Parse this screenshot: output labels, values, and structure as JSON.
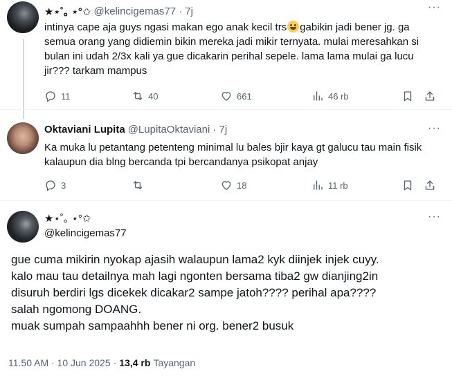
{
  "tweets": [
    {
      "name": "★⋆˚｡ ⋆°✩",
      "handle": "@kelincigemas77",
      "time": "· 7j",
      "text_parts": [
        "intinya cape aja guys ngasi makan ego anak kecil trs",
        "gabikin jadi bener jg. ga semua orang yang didiemin bikin mereka jadi mikir ternyata. mulai meresahkan si bulan ini udah 2/3x kali ya gue dicakarin perihal sepele. lama lama mulai ga lucu jir??? tarkam mampus"
      ],
      "emoji": "grinning-face-emoji",
      "replies": "11",
      "reposts": "40",
      "likes": "661",
      "views": "46 rb"
    },
    {
      "name": "Oktaviani Lupita",
      "handle": "@LupitaOktaviani",
      "time": "· 7j",
      "text": "Ka muka lu petantang petenteng minimal lu bales bjir kaya gt galucu tau main fisik kalaupun dia blng bercanda tpi bercandanya psikopat anjay",
      "replies": "3",
      "reposts": "",
      "likes": "18",
      "views": "11 rb"
    }
  ],
  "main": {
    "name": "★⋆˚｡ ⋆°✩",
    "handle": "@kelincigemas77",
    "lines": [
      "gue cuma mikirin nyokap ajasih walaupun lama2 kyk diinjek injek cuyy.",
      "kalo mau tau detailnya mah lagi ngonten bersama tiba2 gw dianjing2in",
      "disuruh berdiri lgs dicekek dicakar2 sampe jatoh???? perihal apa????",
      "salah ngomong DOANG.",
      "muak sumpah sampaahhh bener ni org. bener2 busuk"
    ],
    "timestamp": "11.50 AM · 10 Jun 2025",
    "separator": "·",
    "views": "13,4 rb",
    "views_label": "Tayangan"
  },
  "icons": {
    "reply": "reply-icon",
    "repost": "repost-icon",
    "like": "like-icon",
    "views": "views-icon",
    "bookmark": "bookmark-icon",
    "share": "share-icon",
    "more": "more-icon"
  },
  "more_glyph": "···",
  "colors": {
    "text": "#0f1419",
    "muted": "#536471",
    "border": "#eff3f4",
    "thread": "#cfd9de"
  }
}
